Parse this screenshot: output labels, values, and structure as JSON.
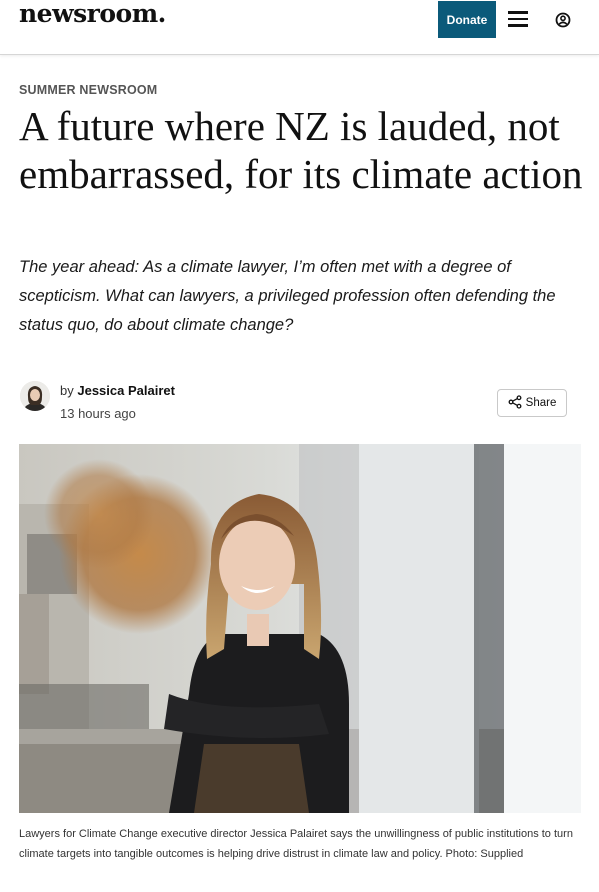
{
  "header": {
    "logo": "newsroom.",
    "donate_label": "Donate",
    "menu_icon": "hamburger-menu-icon",
    "account_icon": "user-circle-icon",
    "brand_color": "#0b5a7a"
  },
  "article": {
    "kicker": "SUMMER NEWSROOM",
    "headline": "A future where NZ is lauded, not embarrassed, for its climate action",
    "dek": "The year ahead: As a climate lawyer, I’m often met with a degree of scepticism. What can lawyers, a privileged profession often defending the status quo, do about climate change?",
    "byline_prefix": "by",
    "author": "Jessica Palairet",
    "timestamp": "13 hours ago",
    "share_label": "Share",
    "share_icon": "share-icon",
    "caption": "Lawyers for Climate Change executive director Jessica Palairet says the unwillingness of public institutions to turn climate targets into tangible outcomes is helping drive distrust in climate law and policy. Photo: Supplied"
  }
}
